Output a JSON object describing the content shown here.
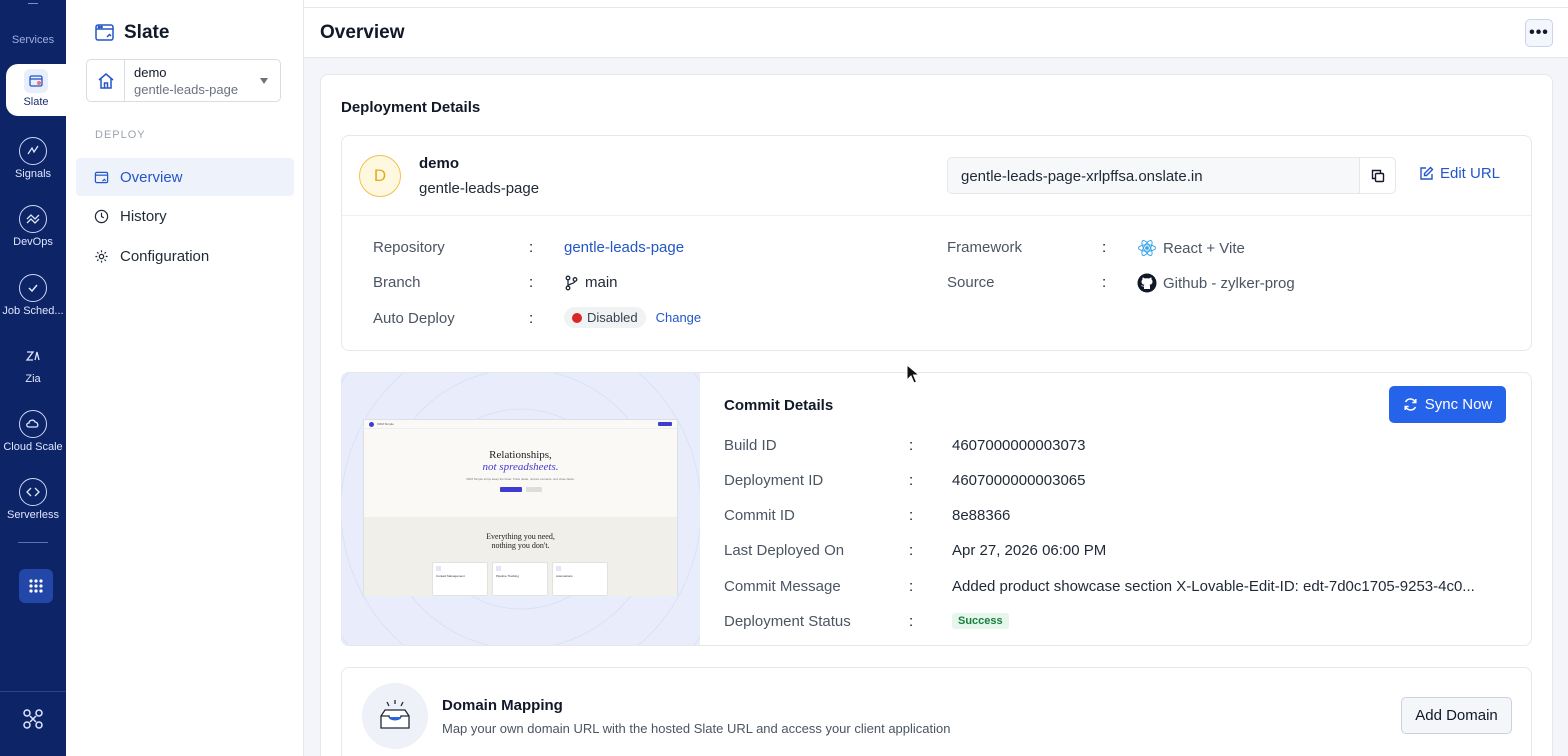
{
  "rail": {
    "title": "Services",
    "items": [
      {
        "label": "Slate",
        "icon": "slate-icon",
        "active": true
      },
      {
        "label": "Signals",
        "icon": "signals-icon"
      },
      {
        "label": "DevOps",
        "icon": "devops-icon"
      },
      {
        "label": "Job Sched...",
        "icon": "job-scheduling-icon"
      },
      {
        "label": "Zia",
        "icon": "zia-icon"
      },
      {
        "label": "Cloud Scale",
        "icon": "cloud-scale-icon"
      },
      {
        "label": "Serverless",
        "icon": "serverless-icon"
      }
    ]
  },
  "sidebar": {
    "app_title": "Slate",
    "project": {
      "name": "demo",
      "app": "gentle-leads-page"
    },
    "section_label": "DEPLOY",
    "nav": [
      {
        "label": "Overview",
        "icon": "overview-icon",
        "active": true
      },
      {
        "label": "History",
        "icon": "clock-icon"
      },
      {
        "label": "Configuration",
        "icon": "gear-icon"
      }
    ]
  },
  "header": {
    "title": "Overview",
    "more": "•••"
  },
  "deployment": {
    "section_title": "Deployment Details",
    "avatar_letter": "D",
    "name": "demo",
    "app": "gentle-leads-page",
    "url": "gentle-leads-page-xrlpffsa.onslate.in",
    "edit_url_label": "Edit URL",
    "fields": {
      "repository": {
        "label": "Repository",
        "value": "gentle-leads-page"
      },
      "branch": {
        "label": "Branch",
        "value": "main"
      },
      "auto_deploy": {
        "label": "Auto Deploy",
        "value": "Disabled",
        "change": "Change"
      },
      "framework": {
        "label": "Framework",
        "value": "React + Vite"
      },
      "source": {
        "label": "Source",
        "value": "Github - zylker-prog"
      }
    },
    "colon": ":"
  },
  "preview": {
    "nav_brand": "CRM Simple",
    "headline_1": "Relationships,",
    "headline_2": "not spreadsheets.",
    "sub": "CRM Simple strips away the bloat. Track deals, nurture contacts, and close faster.",
    "section_heading_1": "Everything you need,",
    "section_heading_2": "nothing you don't.",
    "cards": [
      "Contact Management",
      "Pipeline Tracking",
      "Automations"
    ]
  },
  "commit": {
    "title": "Commit Details",
    "sync_label": "Sync Now",
    "rows": [
      {
        "label": "Build ID",
        "value": "4607000000003073"
      },
      {
        "label": "Deployment ID",
        "value": "4607000000003065"
      },
      {
        "label": "Commit ID",
        "value": "8e88366"
      },
      {
        "label": "Last Deployed On",
        "value": "Apr 27, 2026 06:00 PM"
      },
      {
        "label": "Commit Message",
        "value": "Added product showcase section X-Lovable-Edit-ID: edt-7d0c1705-9253-4c0..."
      },
      {
        "label": "Deployment Status",
        "value": "Success"
      }
    ]
  },
  "domain": {
    "title": "Domain Mapping",
    "description": "Map your own domain URL with the hosted Slate URL and access your client application",
    "button": "Add Domain"
  },
  "colors": {
    "accent": "#2563eb",
    "rail": "#0d2466",
    "success": "#15803d",
    "disabled": "#dc2626"
  }
}
